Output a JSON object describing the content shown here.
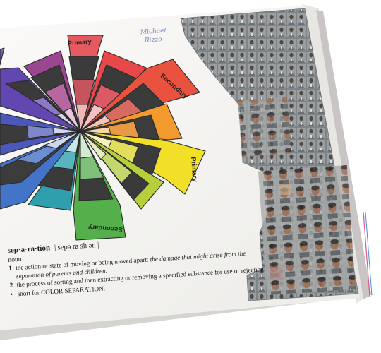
{
  "photo": {
    "subject": "open art book page with a hand-colored color wheel and a dictionary definition, next to a photo-collage column of repeated portrait faces",
    "colors": {
      "page": "#f7f5f2",
      "ink_outline": "#2a2a2a",
      "collage_bg": "#8d9092"
    }
  },
  "wheel": {
    "segment_labels": {
      "primary_top": "Primary",
      "secondary_right": "Secondary",
      "primary_right": "Primary",
      "secondary_bottom": "Secondary"
    },
    "handwriting": {
      "line1": "Michael",
      "line2": "Rizzo"
    }
  },
  "definition": {
    "headword": "sep·a·ra·tion",
    "pronunciation": "| sepə rā sh ən |",
    "part_of_speech": "noun",
    "sense1_num": "1",
    "sense1_text": "the action or state of moving or being moved apart: ",
    "sense1_example": "the damage that might arise from the separation of parents and children.",
    "sense2_num": "2",
    "sense2_text": "the process of sorting and then extracting or removing a specified substance for use or rejection.",
    "sense3_bullet": "•",
    "sense3_text": "short for ",
    "sense3_ref": "COLOR SEPARATION",
    "sense3_end": "."
  }
}
